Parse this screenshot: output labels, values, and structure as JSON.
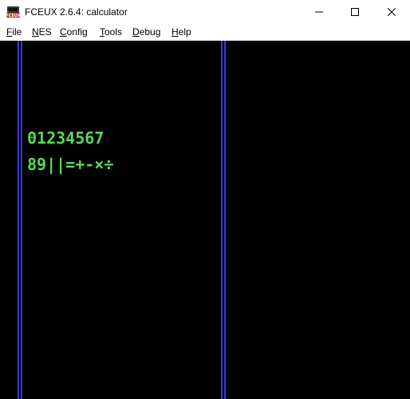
{
  "window": {
    "title": "FCEUX 2.6.4: calculator",
    "icon": "fceux-app-icon",
    "controls": {
      "minimize_icon": "minimize-icon",
      "maximize_icon": "maximize-icon",
      "close_icon": "close-icon"
    }
  },
  "menu": {
    "items": [
      {
        "acc": "F",
        "rest": "ile"
      },
      {
        "acc": "N",
        "rest": "ES"
      },
      {
        "acc": "C",
        "rest": "onfig"
      },
      {
        "acc": "T",
        "rest": "ools"
      },
      {
        "acc": "D",
        "rest": "ebug"
      },
      {
        "acc": "H",
        "rest": "elp"
      }
    ]
  },
  "game_screen": {
    "background_color": "#000000",
    "border_line_color": "#3a3ad9",
    "glyph_color": "#58d858",
    "rows": [
      "01234567",
      "89||=+-×÷"
    ]
  }
}
